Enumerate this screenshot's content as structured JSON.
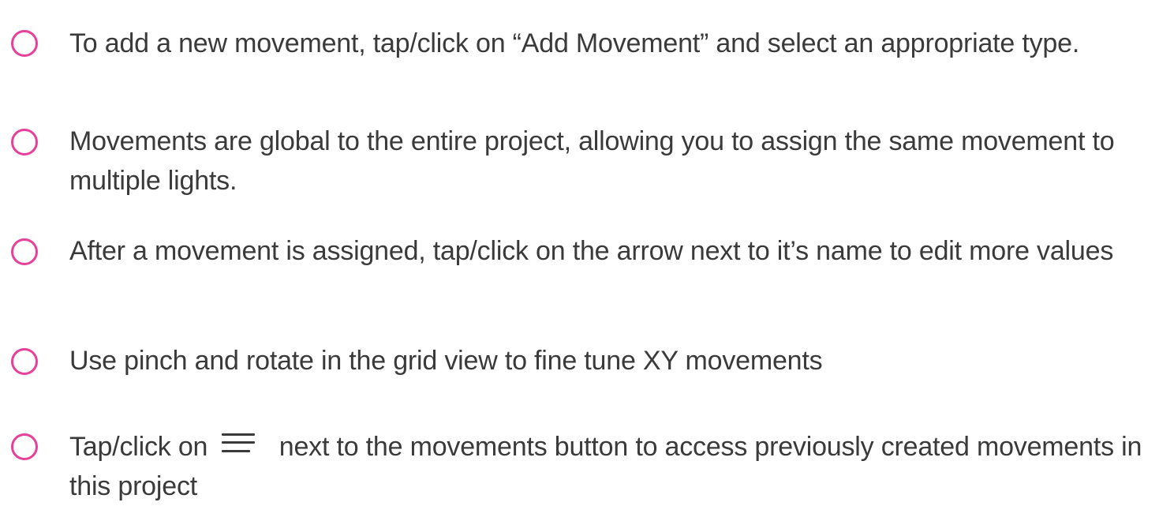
{
  "tips": [
    {
      "text": "To add a new movement, tap/click on “Add Movement” and select an appropriate type."
    },
    {
      "text": "Movements are global to the entire project, allowing you to assign the same movement to multiple lights."
    },
    {
      "text": "After a movement is assigned, tap/click on the arrow next to it’s name to edit more values"
    },
    {
      "text": "Use pinch and rotate in the grid view to fine tune XY movements"
    },
    {
      "text_before_icon": "Tap/click on",
      "icon": "list-lines-icon",
      "text_after_icon": "next to the movements button to access previously created movements in this project"
    }
  ],
  "colors": {
    "check_ring": "#e8409a",
    "text": "#3a3a3a",
    "background": "#ffffff"
  }
}
